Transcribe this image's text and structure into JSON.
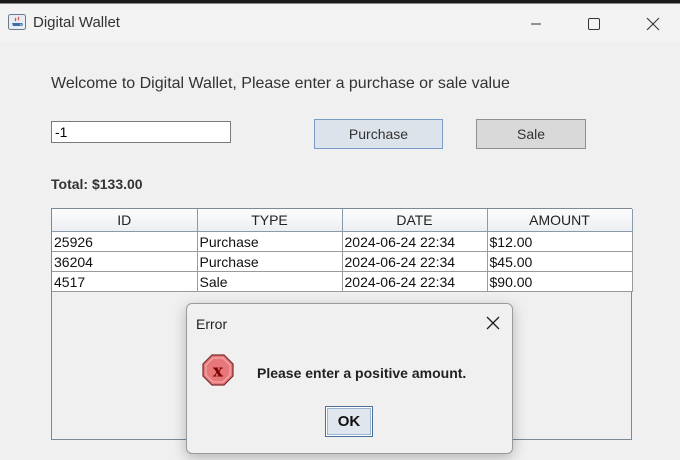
{
  "window": {
    "title": "Digital Wallet",
    "controls": [
      "minimize",
      "maximize",
      "close"
    ]
  },
  "main": {
    "welcome_text": "Welcome to Digital Wallet, Please enter a purchase or sale value",
    "amount_input_value": "-1",
    "purchase_label": "Purchase",
    "sale_label": "Sale",
    "total_text": "Total: $133.00"
  },
  "table": {
    "columns": [
      "ID",
      "TYPE",
      "DATE",
      "AMOUNT"
    ],
    "rows": [
      [
        "25926",
        "Purchase",
        "2024-06-24 22:34",
        "$12.00"
      ],
      [
        "36204",
        "Purchase",
        "2024-06-24 22:34",
        "$45.00"
      ],
      [
        "4517",
        "Sale",
        "2024-06-24 22:34",
        "$90.00"
      ]
    ]
  },
  "dialog": {
    "title": "Error",
    "message": "Please enter a positive amount.",
    "ok_label": "OK",
    "icon": "error-icon"
  },
  "colors": {
    "error_icon_fill": "#e8777a",
    "error_icon_x": "#8b0000",
    "focus_border": "#7a9cc6"
  }
}
